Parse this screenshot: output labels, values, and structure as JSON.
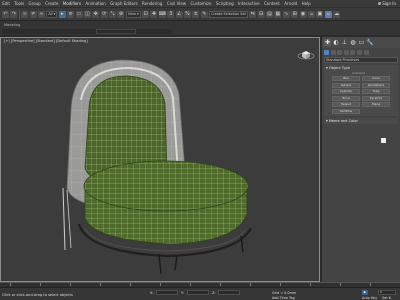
{
  "menu": {
    "items": [
      "Edit",
      "Tools",
      "Group",
      "Create",
      "Modifiers",
      "Animation",
      "Graph Editors",
      "Rendering",
      "Civil View",
      "Customize",
      "Scripting",
      "Interactive",
      "Content",
      "Arnold",
      "Help"
    ],
    "user_initial": "J",
    "sign_in": "Sign In"
  },
  "toolbar": {
    "selection_set_placeholder": "Create Selection Set"
  },
  "ribbon": {
    "tab": "Modeling"
  },
  "viewport": {
    "label": "[+] [Perspective] [Standard] [Default Shading]",
    "accent_color": "#4e6b2a"
  },
  "command_panel": {
    "category": "Standard Primitives",
    "rollout_object_type": "Object Type",
    "autogrid_label": "AutoGrid",
    "object_buttons": [
      "Box",
      "Cone",
      "Sphere",
      "GeoSphere",
      "Cylinder",
      "Tube",
      "Torus",
      "Pyramid",
      "Teapot",
      "Plane",
      "TextPlus"
    ],
    "rollout_name_color": "Name and Color",
    "swatch_color": "#ededed"
  },
  "status": {
    "message": "Click or click-and-drag to select objects",
    "x_label": "X:",
    "y_label": "Y:",
    "z_label": "Z:",
    "grid_label": "Grid = 0.0mm",
    "add_time_tag": "Add Time Tag",
    "frame": "0",
    "auto_key": "Auto Key",
    "set_key": "Set K."
  }
}
